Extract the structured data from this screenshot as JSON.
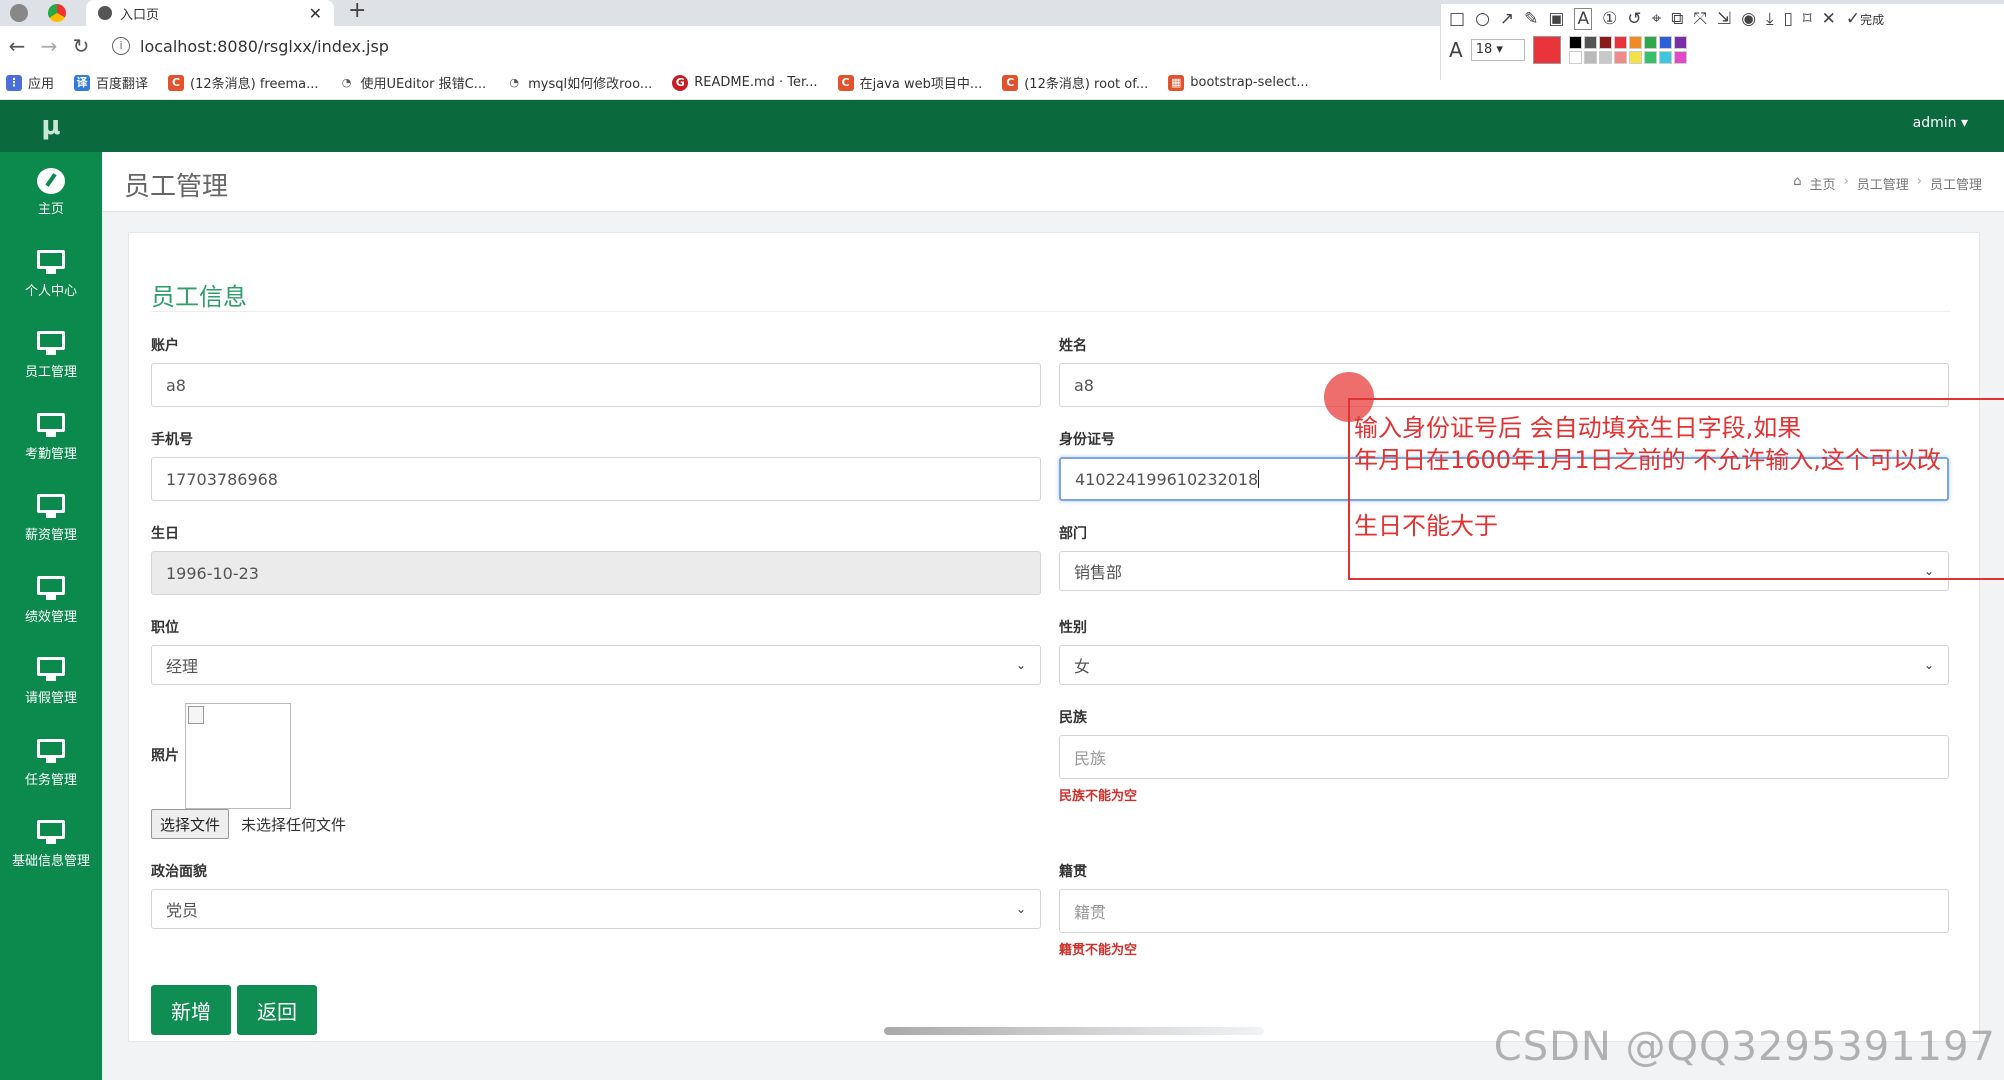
{
  "browser": {
    "tab_title": "入口页",
    "url": "localhost:8080/rsglxx/index.jsp",
    "bookmarks": [
      {
        "label": "应用",
        "icon": "apps-grid-icon",
        "color": "#4a6fd8"
      },
      {
        "label": "百度翻译",
        "icon": "baidu-translate-icon",
        "color": "#2f7be0"
      },
      {
        "label": "(12条消息) freema...",
        "icon": "csdn-icon",
        "color": "#e2522c"
      },
      {
        "label": "使用UEditor 报错C...",
        "icon": "globe-icon",
        "color": "#555555"
      },
      {
        "label": "mysql如何修改roo...",
        "icon": "globe-icon",
        "color": "#555555"
      },
      {
        "label": "README.md · Ter...",
        "icon": "gitee-icon",
        "color": "#c71d23"
      },
      {
        "label": "在java web项目中...",
        "icon": "csdn-icon",
        "color": "#e2522c"
      },
      {
        "label": "(12条消息) root of...",
        "icon": "csdn-icon",
        "color": "#e2522c"
      },
      {
        "label": "bootstrap-select...",
        "icon": "csdn-icon",
        "color": "#e2522c"
      }
    ]
  },
  "snip_tool": {
    "font_size": "18",
    "done_label": "完成",
    "active_color": "#e8343a",
    "palette": [
      "#000000",
      "#555555",
      "#8b1a1a",
      "#e8343a",
      "#f08a24",
      "#2ea84a",
      "#2e5fd8",
      "#7a2ea8",
      "#ffffff",
      "#bbbbbb",
      "#c8c8c8",
      "#f28a8a",
      "#f5e04a",
      "#36c06a",
      "#3ec6e0",
      "#e04ac6"
    ]
  },
  "app": {
    "logo": "μ",
    "user": "admin ▾",
    "sidebar": [
      {
        "label": "主页",
        "icon": "dashboard-icon"
      },
      {
        "label": "个人中心",
        "icon": "monitor-icon"
      },
      {
        "label": "员工管理",
        "icon": "monitor-icon"
      },
      {
        "label": "考勤管理",
        "icon": "monitor-icon"
      },
      {
        "label": "薪资管理",
        "icon": "monitor-icon"
      },
      {
        "label": "绩效管理",
        "icon": "monitor-icon"
      },
      {
        "label": "请假管理",
        "icon": "monitor-icon"
      },
      {
        "label": "任务管理",
        "icon": "monitor-icon"
      },
      {
        "label": "基础信息管理",
        "icon": "monitor-icon"
      }
    ],
    "page_title": "员工管理",
    "breadcrumb": [
      "主页",
      "员工管理",
      "员工管理"
    ]
  },
  "form": {
    "title": "员工信息",
    "account": {
      "label": "账户",
      "value": "a8"
    },
    "name": {
      "label": "姓名",
      "value": "a8"
    },
    "phone": {
      "label": "手机号",
      "value": "17703786968"
    },
    "id_number": {
      "label": "身份证号",
      "value": "410224199610232018"
    },
    "birthday": {
      "label": "生日",
      "value": "1996-10-23"
    },
    "department": {
      "label": "部门",
      "value": "销售部"
    },
    "position": {
      "label": "职位",
      "value": "经理"
    },
    "gender": {
      "label": "性别",
      "value": "女"
    },
    "photo": {
      "label": "照片",
      "choose_file": "选择文件",
      "no_file": "未选择任何文件"
    },
    "ethnicity": {
      "label": "民族",
      "placeholder": "民族",
      "error": "民族不能为空"
    },
    "political": {
      "label": "政治面貌",
      "value": "党员"
    },
    "native_place": {
      "label": "籍贯",
      "placeholder": "籍贯",
      "error": "籍贯不能为空"
    },
    "submit_label": "新增",
    "back_label": "返回"
  },
  "annotation": {
    "line1": "输入身份证号后 会自动填充生日字段,如果",
    "line2": "年月日在1600年1月1日之前的 不允许输入,这个可以改",
    "line3": "生日不能大于",
    "color": "#e23232"
  },
  "watermark": "CSDN @QQ3295391197"
}
